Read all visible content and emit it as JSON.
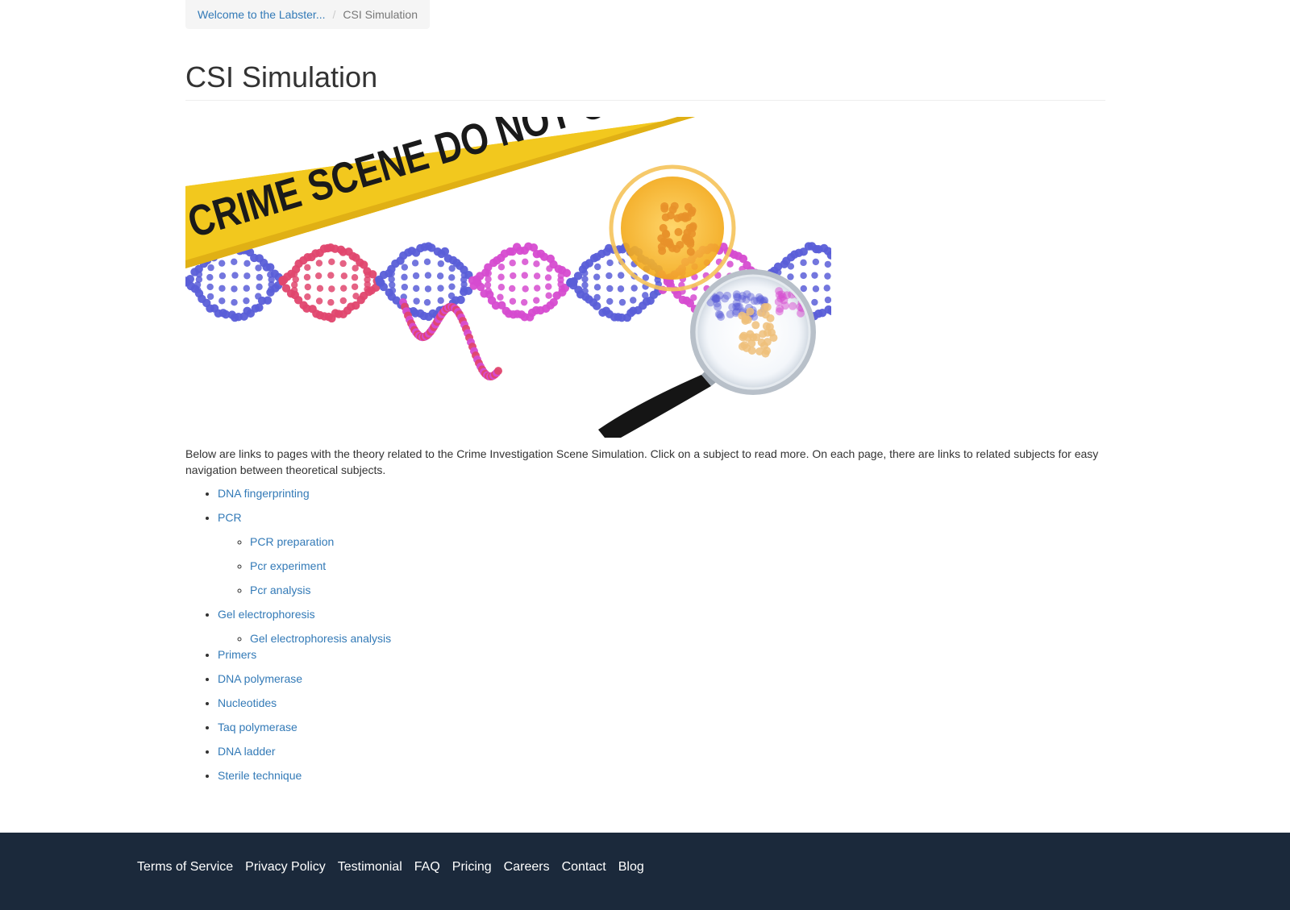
{
  "breadcrumb": {
    "parent": "Welcome to the Labster...",
    "separator": "/",
    "current": "CSI Simulation"
  },
  "page": {
    "title": "CSI Simulation",
    "hero_tape_text": "CRIME SCENE DO NOT CROSS",
    "intro": "Below are links to pages with the theory related to the Crime Investigation Scene Simulation. Click on a subject to read more. On each page, there are links to related subjects for easy navigation between theoretical subjects."
  },
  "topics": [
    {
      "label": "DNA fingerprinting"
    },
    {
      "label": "PCR",
      "children": [
        {
          "label": "PCR preparation"
        },
        {
          "label": "Pcr experiment"
        },
        {
          "label": "Pcr analysis"
        }
      ]
    },
    {
      "label": "Gel electrophoresis",
      "children": [
        {
          "label": "Gel electrophoresis analysis"
        }
      ]
    },
    {
      "label": "Primers"
    },
    {
      "label": "DNA polymerase"
    },
    {
      "label": "Nucleotides"
    },
    {
      "label": "Taq polymerase"
    },
    {
      "label": "DNA ladder"
    },
    {
      "label": "Sterile technique"
    }
  ],
  "footer": {
    "links": [
      "Terms of Service",
      "Privacy Policy",
      "Testimonial",
      "FAQ",
      "Pricing",
      "Careers",
      "Contact",
      "Blog"
    ]
  },
  "colors": {
    "link": "#337ab7",
    "footer_bg": "#1b293b",
    "tape_yellow": "#f2c81e",
    "dna_blue": "#5a5ed8",
    "dna_red": "#e0466e",
    "dna_magenta": "#d64bd0"
  }
}
